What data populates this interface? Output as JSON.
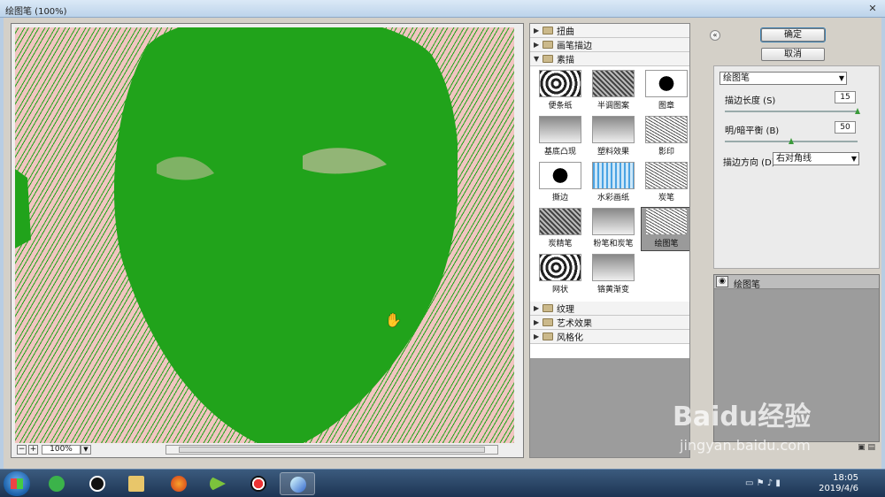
{
  "window": {
    "title": "绘图笔 (100%)",
    "close_icon": "close-icon"
  },
  "preview": {
    "zoom_minus": "−",
    "zoom_plus": "+",
    "zoom_value": "100%",
    "cursor_icon": "hand-cursor-icon"
  },
  "gallery": {
    "categories_top": [
      {
        "label": "扭曲",
        "expanded": false
      },
      {
        "label": "画笔描边",
        "expanded": false
      },
      {
        "label": "素描",
        "expanded": true
      }
    ],
    "thumbnails": [
      {
        "label": "便条纸",
        "selected": false
      },
      {
        "label": "半调图案",
        "selected": false
      },
      {
        "label": "图章",
        "selected": false
      },
      {
        "label": "基底凸现",
        "selected": false
      },
      {
        "label": "塑料效果",
        "selected": false
      },
      {
        "label": "影印",
        "selected": false
      },
      {
        "label": "撕边",
        "selected": false
      },
      {
        "label": "水彩画纸",
        "selected": false
      },
      {
        "label": "炭笔",
        "selected": false
      },
      {
        "label": "炭精笔",
        "selected": false
      },
      {
        "label": "粉笔和炭笔",
        "selected": false
      },
      {
        "label": "绘图笔",
        "selected": true
      },
      {
        "label": "网状",
        "selected": false
      },
      {
        "label": "铬黄渐变",
        "selected": false
      }
    ],
    "categories_bottom": [
      {
        "label": "纹理",
        "expanded": false
      },
      {
        "label": "艺术效果",
        "expanded": false
      },
      {
        "label": "风格化",
        "expanded": false
      }
    ]
  },
  "settings": {
    "ok_label": "确定",
    "cancel_label": "取消",
    "filter_select": "绘图笔",
    "stroke_length_label": "描边长度 (S)",
    "stroke_length_value": "15",
    "stroke_length_level": 1.0,
    "light_dark_label": "明/暗平衡 (B)",
    "light_dark_value": "50",
    "light_dark_level": 0.5,
    "stroke_dir_label": "描边方向 (D):",
    "stroke_dir_value": "右对角线"
  },
  "layers": {
    "items": [
      {
        "name": "绘图笔",
        "visible": true
      }
    ]
  },
  "taskbar": {
    "time": "18:05",
    "date": "2019/4/6",
    "icons": [
      "app-360-icon",
      "qq-icon",
      "file-explorer-icon",
      "firefox-icon",
      "media-player-icon",
      "record-icon",
      "photoshop-feather-icon"
    ]
  },
  "watermark": {
    "brand": "Baidu经验",
    "url": "jingyan.baidu.com"
  },
  "colors": {
    "preview_green": "#21a31b",
    "preview_pink": "#f1c5c1"
  }
}
